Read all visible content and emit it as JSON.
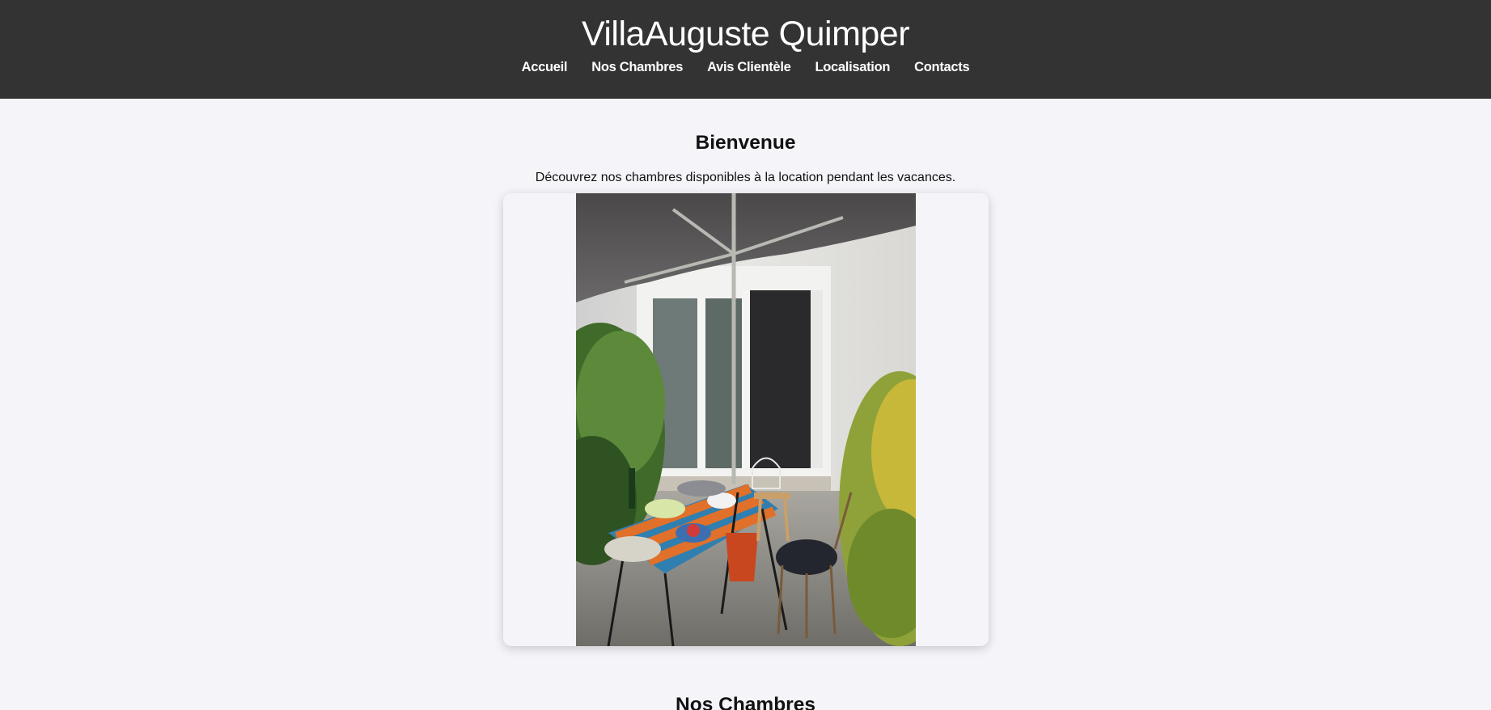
{
  "header": {
    "title": "VillaAuguste Quimper",
    "nav": [
      {
        "label": "Accueil"
      },
      {
        "label": "Nos Chambres"
      },
      {
        "label": "Avis Clientèle"
      },
      {
        "label": "Localisation"
      },
      {
        "label": "Contacts"
      }
    ]
  },
  "welcome": {
    "title": "Bienvenue",
    "text": "Découvrez nos chambres disponibles à la location pendant les vacances."
  },
  "rooms_section": {
    "title": "Nos Chambres"
  },
  "colors": {
    "header_bg": "#333333",
    "page_bg": "#f4f4f9"
  }
}
